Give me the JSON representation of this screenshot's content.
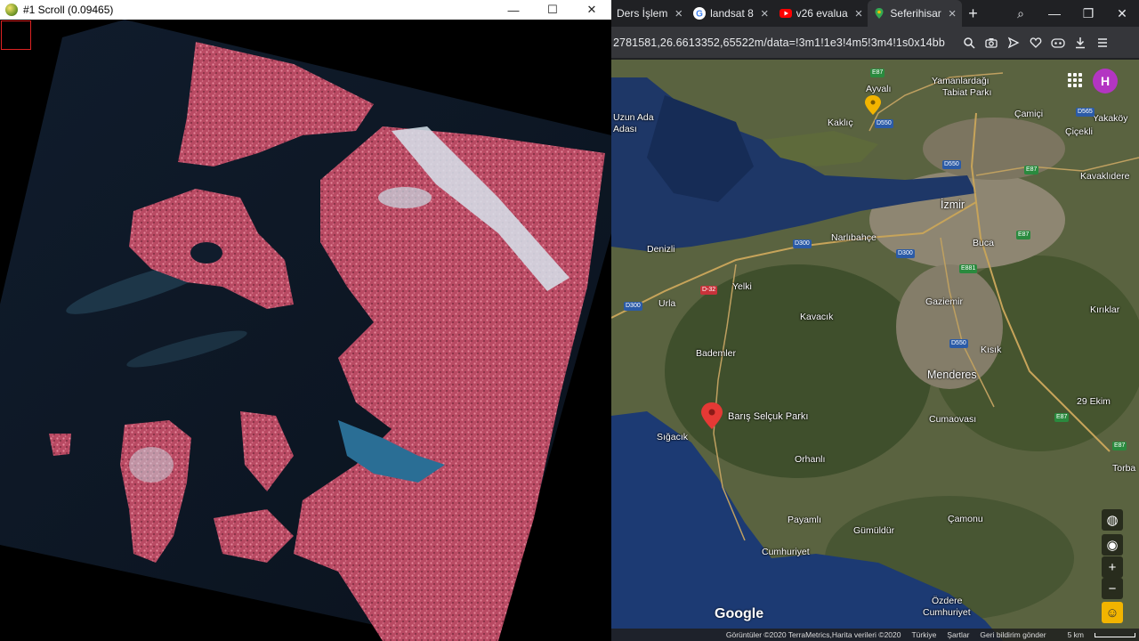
{
  "left_window": {
    "title": "#1 Scroll (0.09465)",
    "controls": {
      "minimize": "—",
      "maximize": "☐",
      "close": "✕"
    }
  },
  "browser": {
    "tabs": [
      {
        "label": "Ders İşlem",
        "icon": "doc-icon"
      },
      {
        "label": "landsat 8",
        "icon": "google-icon"
      },
      {
        "label": "v26 evalua",
        "icon": "youtube-icon"
      },
      {
        "label": "Seferihisar",
        "icon": "maps-icon",
        "active": true
      }
    ],
    "new_tab": "+",
    "tab_tools": {
      "search": "⌕",
      "minimize": "—",
      "restore": "❐",
      "close": "✕"
    },
    "url": "2781581,26.6613352,65522m/data=!3m1!1e3!4m5!3m4!1s0x14bb",
    "address_icons": [
      "search-icon",
      "camera-icon",
      "send-icon",
      "heart-icon",
      "extension-icon",
      "download-icon",
      "menu-icon"
    ]
  },
  "map": {
    "labels": [
      {
        "text": "Yamanlardağı",
        "cls": ""
      },
      {
        "text": "Tabiat Parkı",
        "cls": ""
      },
      {
        "text": "Ayvalı",
        "cls": ""
      },
      {
        "text": "Kaklıç",
        "cls": ""
      },
      {
        "text": "Çamiçi",
        "cls": ""
      },
      {
        "text": "Çiçekli",
        "cls": ""
      },
      {
        "text": "Yakaköy",
        "cls": ""
      },
      {
        "text": "Kavaklıdere",
        "cls": ""
      },
      {
        "text": "Uzun Ada",
        "cls": ""
      },
      {
        "text": "Adası",
        "cls": ""
      },
      {
        "text": "İzmir",
        "cls": "big"
      },
      {
        "text": "Narlıbahçe",
        "cls": ""
      },
      {
        "text": "Buca",
        "cls": ""
      },
      {
        "text": "Denizli",
        "cls": ""
      },
      {
        "text": "Yelki",
        "cls": ""
      },
      {
        "text": "Urla",
        "cls": ""
      },
      {
        "text": "Gaziemir",
        "cls": ""
      },
      {
        "text": "Kavacık",
        "cls": ""
      },
      {
        "text": "Kırıklar",
        "cls": ""
      },
      {
        "text": "Bademler",
        "cls": ""
      },
      {
        "text": "Kısık",
        "cls": ""
      },
      {
        "text": "Menderes",
        "cls": "big"
      },
      {
        "text": "Barış Selçuk Parkı",
        "cls": ""
      },
      {
        "text": "Sığacık",
        "cls": ""
      },
      {
        "text": "Cumaovası",
        "cls": ""
      },
      {
        "text": "29 Ekim",
        "cls": ""
      },
      {
        "text": "Orhanlı",
        "cls": ""
      },
      {
        "text": "Torba",
        "cls": ""
      },
      {
        "text": "Payamlı",
        "cls": ""
      },
      {
        "text": "Çamonu",
        "cls": ""
      },
      {
        "text": "Gümüldür",
        "cls": ""
      },
      {
        "text": "Cumhuriyet",
        "cls": ""
      },
      {
        "text": "Özdere",
        "cls": ""
      },
      {
        "text": "Cumhuriyet",
        "cls": ""
      }
    ],
    "shields": [
      {
        "text": "E87",
        "color": "green"
      },
      {
        "text": "D550",
        "color": "blue"
      },
      {
        "text": "D565",
        "color": "blue"
      },
      {
        "text": "D550",
        "color": "blue"
      },
      {
        "text": "E87",
        "color": "green"
      },
      {
        "text": "D300",
        "color": "blue"
      },
      {
        "text": "D300",
        "color": "blue"
      },
      {
        "text": "E87",
        "color": "green"
      },
      {
        "text": "E881",
        "color": "green"
      },
      {
        "text": "D-32",
        "color": "red"
      },
      {
        "text": "D300",
        "color": "blue"
      },
      {
        "text": "D550",
        "color": "blue"
      },
      {
        "text": "E87",
        "color": "green"
      },
      {
        "text": "E87",
        "color": "green"
      }
    ],
    "avatar_letter": "H",
    "logo": "Google",
    "attribution": {
      "imagery": "Görüntüler ©2020 TerraMetrics,Harita verileri ©2020",
      "country": "Türkiye",
      "terms": "Şartlar",
      "feedback": "Geri bildirim gönder",
      "scale": "5 km"
    },
    "controls": {
      "globe": "◍",
      "locate": "◉",
      "zoom_in": "+",
      "zoom_out": "−",
      "pegman": "☺"
    }
  }
}
